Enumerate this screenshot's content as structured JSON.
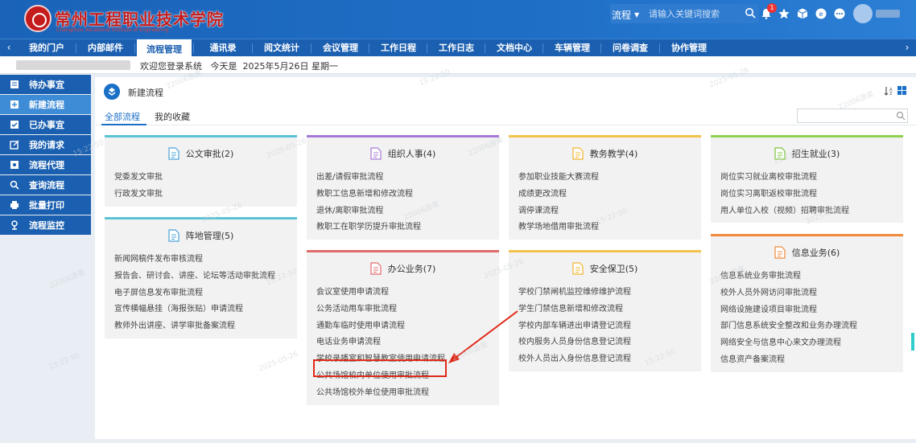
{
  "header": {
    "logo_cn": "常州工程职业技术学院",
    "logo_en": "Changzhou Vocational Institute of Engineering",
    "scope_label": "流程",
    "search_placeholder": "请输入关键词搜索",
    "notification_count": "1"
  },
  "nav": {
    "items": [
      "我的门户",
      "内部邮件",
      "流程管理",
      "通讯录",
      "阅文统计",
      "会议管理",
      "工作日程",
      "工作日志",
      "文档中心",
      "车辆管理",
      "问卷调查",
      "协作管理"
    ],
    "active_index": 2
  },
  "infobar": {
    "welcome": "欢迎您登录系统",
    "today_label": "今天是",
    "date": "2025年5月26日 星期一"
  },
  "sidebar": {
    "items": [
      {
        "label": "待办事宜",
        "icon": "todo-icon"
      },
      {
        "label": "新建流程",
        "icon": "new-process-icon"
      },
      {
        "label": "已办事宜",
        "icon": "done-icon"
      },
      {
        "label": "我的请求",
        "icon": "my-request-icon"
      },
      {
        "label": "流程代理",
        "icon": "proxy-icon"
      },
      {
        "label": "查询流程",
        "icon": "search-icon"
      },
      {
        "label": "批量打印",
        "icon": "print-icon"
      },
      {
        "label": "流程监控",
        "icon": "monitor-icon"
      }
    ],
    "active_index": 1
  },
  "panel": {
    "title": "新建流程",
    "tabs": [
      "全部流程",
      "我的收藏"
    ]
  },
  "categories": [
    {
      "title": "公文审批(2)",
      "color": "#5bc3d6",
      "icon_color": "#4aa3d8",
      "items": [
        "党委发文审批",
        "行政发文审批"
      ]
    },
    {
      "title": "阵地管理(5)",
      "color": "#5bc3d6",
      "icon_color": "#4aa3d8",
      "items": [
        "新闻网稿件发布审核流程",
        "报告会、研讨会、讲座、论坛等活动审批流程",
        "电子屏信息发布审批流程",
        "宣传横幅悬挂（海报张贴）申请流程",
        "教师外出讲座、讲学审批备案流程"
      ]
    },
    {
      "title": "组织人事(4)",
      "color": "#a779d6",
      "icon_color": "#a779d6",
      "items": [
        "出差/请假审批流程",
        "教职工信息新增和修改流程",
        "退休/离职审批流程",
        "教职工在职学历提升审批流程"
      ]
    },
    {
      "title": "办公业务(7)",
      "color": "#e06b6b",
      "icon_color": "#e06b6b",
      "items": [
        "会议室使用申请流程",
        "公务活动用车审批流程",
        "通勤车临时使用申请流程",
        "电话业务申请流程",
        "学校录播室和智慧教室使用申请流程",
        "公共场馆校内单位使用审批流程",
        "公共场馆校外单位使用审批流程"
      ]
    },
    {
      "title": "教务教学(4)",
      "color": "#f2c24a",
      "icon_color": "#f0b42e",
      "items": [
        "参加职业技能大赛流程",
        "成绩更改流程",
        "调停课流程",
        "教学场地借用审批流程"
      ]
    },
    {
      "title": "安全保卫(5)",
      "color": "#f2c24a",
      "icon_color": "#f0b42e",
      "items": [
        "学校门禁闸机监控维修维护流程",
        "学生门禁信息新增和修改流程",
        "学校内部车辆进出申请登记流程",
        "校内服务人员身份信息登记流程",
        "校外人员出入身份信息登记流程"
      ]
    },
    {
      "title": "招生就业(3)",
      "color": "#8fd14f",
      "icon_color": "#7cc43a",
      "items": [
        "岗位实习就业离校审批流程",
        "岗位实习离职返校审批流程",
        "用人单位入校（视频）招聘审批流程"
      ]
    },
    {
      "title": "信息业务(6)",
      "color": "#f08a3c",
      "icon_color": "#f08a3c",
      "items": [
        "信息系统业务审批流程",
        "校外人员外网访问审批流程",
        "网络设施建设项目审批流程",
        "部门信息系统安全整改和业务办理流程",
        "网络安全与信息中心来文办理流程",
        "信息资产备案流程"
      ]
    }
  ],
  "watermark": {
    "line1": "22006游昊",
    "line2": "15:22:50",
    "line3": "2025-05-26"
  }
}
